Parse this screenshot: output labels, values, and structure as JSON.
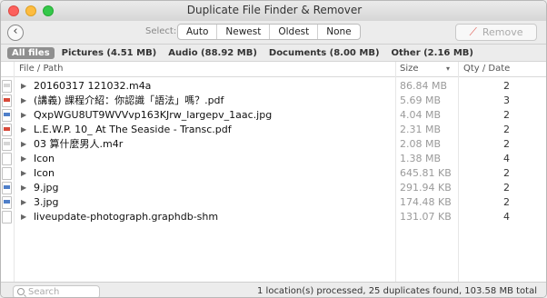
{
  "window": {
    "title": "Duplicate File Finder & Remover"
  },
  "toolbar": {
    "select_label": "Select:",
    "select_options": [
      "Auto",
      "Newest",
      "Oldest",
      "None"
    ],
    "remove_label": "Remove"
  },
  "filters": [
    {
      "label": "All files",
      "active": true
    },
    {
      "label": "Pictures (4.51 MB)",
      "active": false
    },
    {
      "label": "Audio (88.92 MB)",
      "active": false
    },
    {
      "label": "Documents (8.00 MB)",
      "active": false
    },
    {
      "label": "Other (2.16 MB)",
      "active": false
    }
  ],
  "columns": {
    "path": "File / Path",
    "size": "Size",
    "qty": "Qty / Date"
  },
  "rows": [
    {
      "name": "20160317 121032.m4a",
      "size": "86.84 MB",
      "qty": "2",
      "type": "m4a"
    },
    {
      "name": "(講義) 課程介紹：你認識「語法」嗎？.pdf",
      "size": "5.69 MB",
      "qty": "3",
      "type": "pdf"
    },
    {
      "name": "QxpWGU8UT9WVVvp163KJrw_largepv_1aac.jpg",
      "size": "4.04 MB",
      "qty": "2",
      "type": "jpg"
    },
    {
      "name": "L.E.W.P. 10_ At The Seaside - Transc.pdf",
      "size": "2.31 MB",
      "qty": "2",
      "type": "pdf"
    },
    {
      "name": "03 算什麼男人.m4r",
      "size": "2.08 MB",
      "qty": "2",
      "type": "m4r"
    },
    {
      "name": "Icon",
      "size": "1.38 MB",
      "qty": "4",
      "type": "icon"
    },
    {
      "name": "Icon",
      "size": "645.81 KB",
      "qty": "2",
      "type": "icon"
    },
    {
      "name": "9.jpg",
      "size": "291.94 KB",
      "qty": "2",
      "type": "jpg"
    },
    {
      "name": "3.jpg",
      "size": "174.48 KB",
      "qty": "2",
      "type": "jpg"
    },
    {
      "name": "liveupdate-photograph.graphdb-shm",
      "size": "131.07 KB",
      "qty": "4",
      "type": "shm"
    }
  ],
  "status": {
    "search_placeholder": "Search",
    "summary": "1 location(s) processed, 25 duplicates found, 103.58 MB total"
  }
}
